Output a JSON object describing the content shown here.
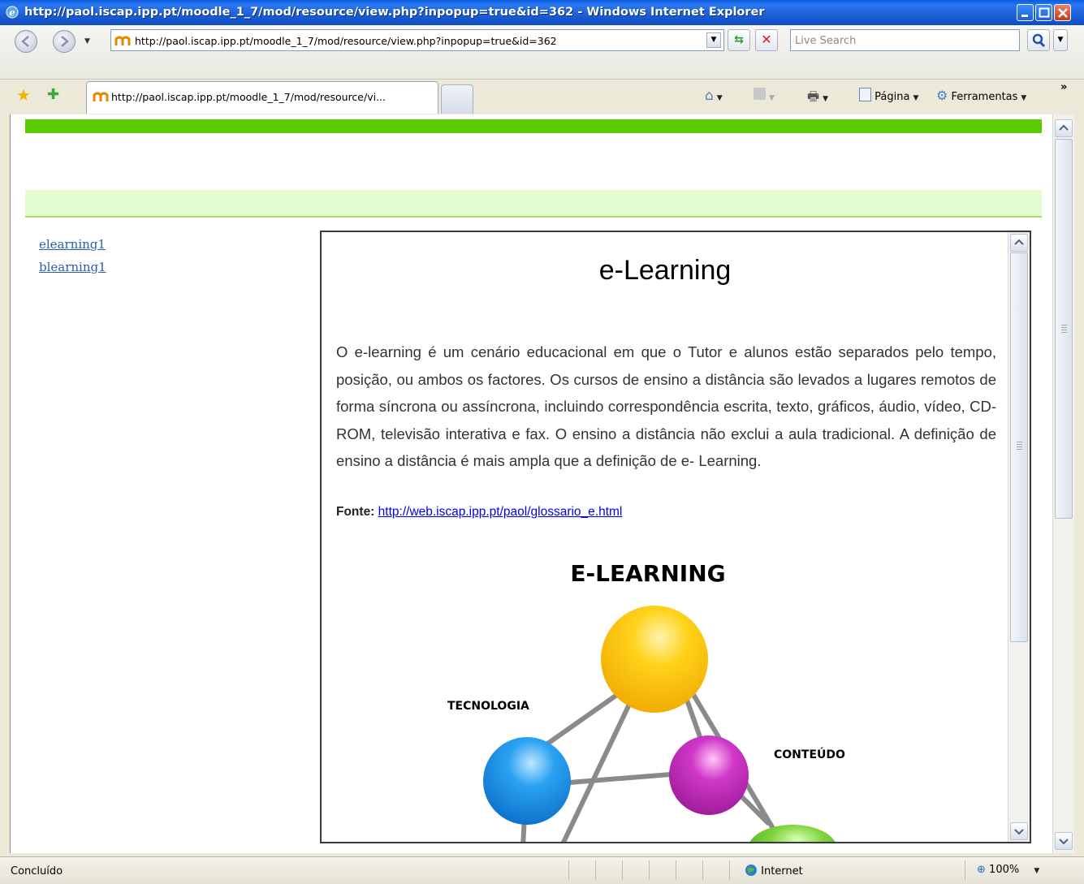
{
  "window": {
    "title": "http://paol.iscap.ipp.pt/moodle_1_7/mod/resource/view.php?inpopup=true&id=362 - Windows Internet Explorer"
  },
  "address": {
    "url": "http://paol.iscap.ipp.pt/moodle_1_7/mod/resource/view.php?inpopup=true&id=362",
    "search_placeholder": "Live Search"
  },
  "tabs": [
    {
      "label": "http://paol.iscap.ipp.pt/moodle_1_7/mod/resource/vi..."
    }
  ],
  "toolbar": {
    "page_label": "Página",
    "tools_label": "Ferramentas"
  },
  "sidebar": {
    "links": [
      "elearning1",
      "blearning1"
    ]
  },
  "content": {
    "title": "e-Learning",
    "paragraph": "O e-learning é um cenário educacional em que o Tutor e alunos estão separados pelo tempo, posição, ou ambos os factores. Os cursos de ensino a distância são levados a lugares remotos de forma síncrona ou assíncrona, incluindo correspondência escrita, texto, gráficos, áudio, vídeo, CD-ROM, televisão interativa e fax. O ensino a distância não exclui a aula tradicional. A definição de ensino a distância é mais ampla que a definição de e- Learning.",
    "source_label": "Fonte:",
    "source_link": "http://web.iscap.ipp.pt/paol/glossario_e.html",
    "diagram": {
      "title": "E-LEARNING",
      "label_tecnologia": "TECNOLOGIA",
      "label_conteudo": "CONTEÚDO"
    }
  },
  "status": {
    "text": "Concluído",
    "zone": "Internet",
    "zoom": "100%"
  }
}
